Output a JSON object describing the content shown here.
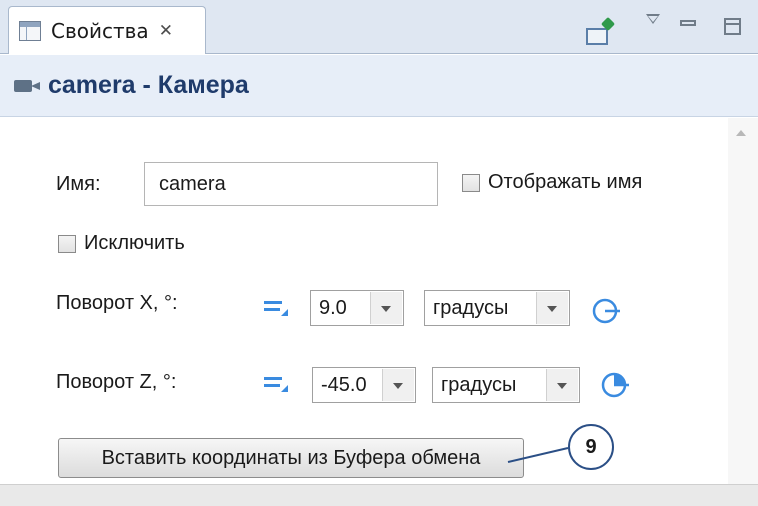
{
  "tab": {
    "label": "Свойства",
    "close_glyph": "✕"
  },
  "header": {
    "title": "camera - Камера",
    "icon": "camera-icon"
  },
  "form": {
    "name_label": "Имя:",
    "name_value": "camera",
    "show_name_label": "Отображать имя",
    "show_name_checked": false,
    "exclude_label": "Исключить",
    "exclude_checked": false,
    "rotation_x": {
      "label": "Поворот X, °:",
      "value": "9.0",
      "unit": "градусы"
    },
    "rotation_z": {
      "label": "Поворот Z, °:",
      "value": "-45.0",
      "unit": "градусы"
    },
    "paste_button_label": "Вставить координаты из Буфера обмена"
  },
  "callout": {
    "number": "9"
  },
  "colors": {
    "accent_blue": "#3a8be0",
    "header_bg": "#e7eef8",
    "title_text": "#1f3b6b",
    "callout_border": "#2b4f86"
  }
}
